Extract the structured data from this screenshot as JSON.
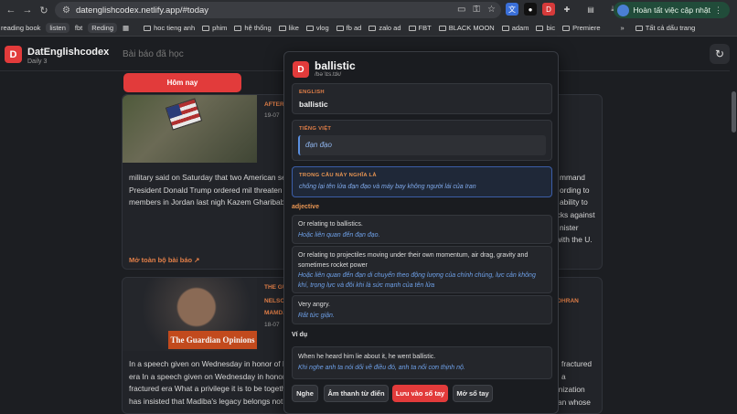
{
  "browser": {
    "url": "datenglishcodex.netlify.app/#today",
    "update_label": "Hoàn tất việc cập nhật",
    "bookmarks": [
      "reading book",
      "listen",
      "fbt",
      "Reding",
      "hoc tieng anh",
      "phim",
      "hệ thống",
      "like",
      "vlog",
      "fb ad",
      "zalo ad",
      "FBT",
      "BLACK MOON",
      "adam",
      "bic",
      "Premiere"
    ],
    "all_bookmarks_label": "Tất cả dấu trang"
  },
  "app": {
    "logo_letter": "D",
    "title": "DatEnglishcodex",
    "subtitle": "Daily 3",
    "bg_heading": "Bài báo đã học",
    "today_button": "Hôm nay",
    "refresh_icon": "refresh-icon"
  },
  "articles": [
    {
      "tag": "AFTER",
      "date": "19-07",
      "text": "military said on Saturday that two American se and partner forces defended against Iranian b Centcom. President Donald Trump ordered mil threaten commercial shipping in the Strait of H American service members in Jordan last nigh Kazem Gharibabadi said the country has susp",
      "right_fragments": [
        "mmand",
        "ording to",
        "ability to",
        "acks against",
        "nister",
        "with the U."
      ],
      "open_link": "Mở toàn bộ bài báo ↗"
    },
    {
      "tag_lines": [
        "THE GU",
        "NELSO",
        "MAMDA"
      ],
      "date": "18-07",
      "badge_line1": "The",
      "badge_line2": "Guardian Opinions",
      "right_tag": "OHRAN",
      "text": "In a speech given on Wednesday in honor of N era In a speech given on Wednesday in honor o fractured era What a privilege it is to be together has insisted that Madiba's legacy belongs not",
      "right_fragments": [
        "fractured",
        "a",
        "organization",
        "an whose"
      ]
    }
  ],
  "popup": {
    "logo_letter": "D",
    "word": "ballistic",
    "ipa": "/bəˈlɪs.tɪk/",
    "english_label": "ENGLISH",
    "english_value": "ballistic",
    "vietnamese_label": "TIẾNG VIỆT",
    "vietnamese_value": "đạn đạo",
    "context_label": "TRONG CÂU NÀY NGHĨA LÀ",
    "context_value": "chống lại tên lửa đạn đạo và máy bay không người lái của Iran",
    "part_of_speech": "adjective",
    "definitions": [
      {
        "en": "Or relating to ballistics.",
        "vi": "Hoặc liên quan đến đạn đạo."
      },
      {
        "en": "Or relating to projectiles moving under their own momentum, air drag, gravity and sometimes rocket power",
        "vi": "Hoặc liên quan đến đạn di chuyển theo động lượng của chính chúng, lực cản không khí, trọng lực và đôi khi là sức mạnh của tên lửa"
      },
      {
        "en": "Very angry.",
        "vi": "Rất tức giận."
      }
    ],
    "example_label": "Ví dụ",
    "example_en": "When he heard him lie about it, he went ballistic.",
    "example_vi": "Khi nghe anh ta nói dối về điều đó, anh ta nổi cơn thịnh nộ.",
    "buttons": {
      "listen": "Nghe",
      "dict_audio": "Âm thanh từ điển",
      "save": "Lưu vào sổ tay",
      "open_notebook": "Mở sổ tay"
    }
  },
  "colors": {
    "accent_red": "#e23b3b",
    "accent_orange": "#e27f48",
    "accent_blue": "#6ea0e8"
  }
}
